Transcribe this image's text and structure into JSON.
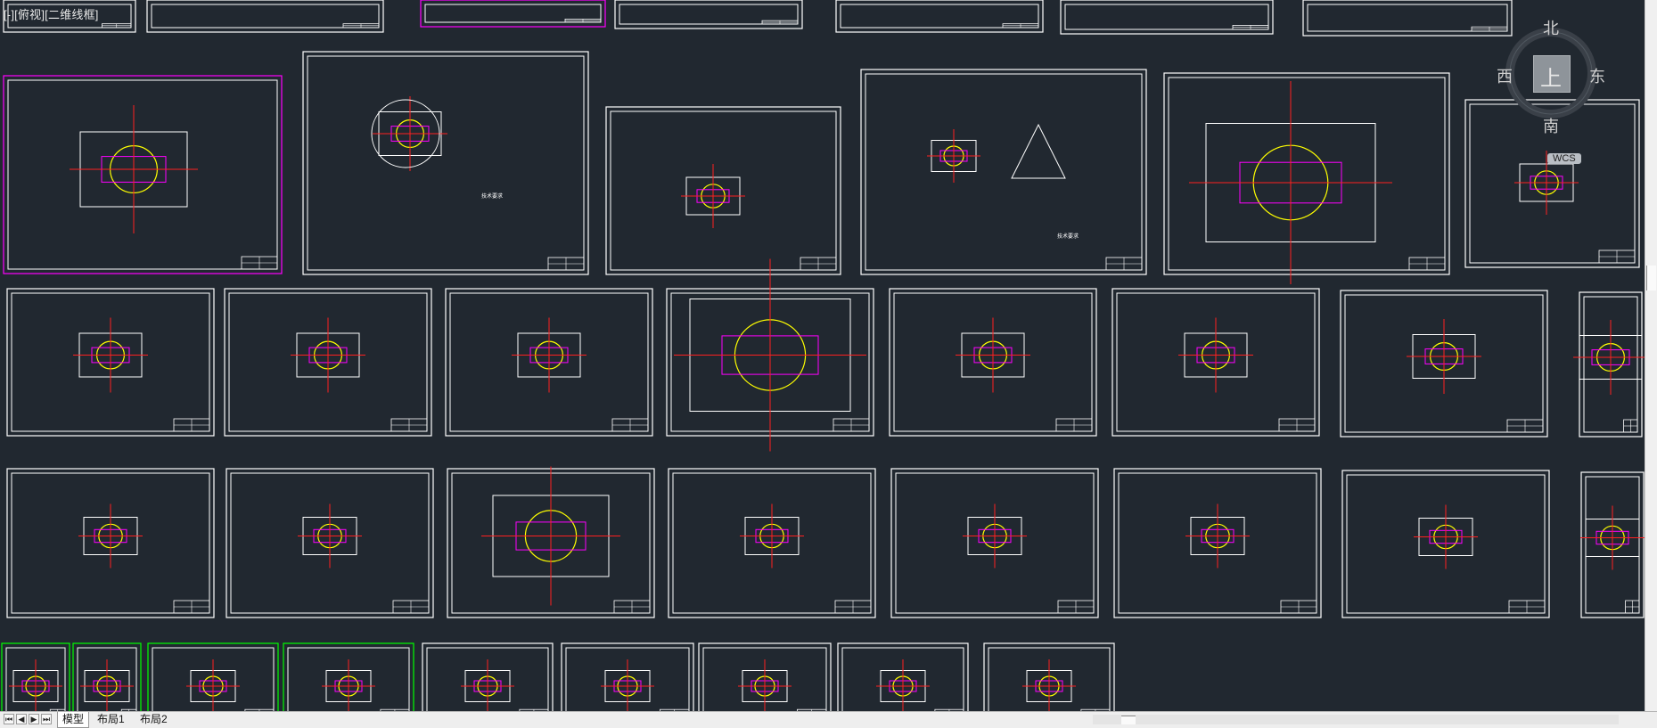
{
  "viewport": {
    "view_label": "[-][俯视][二维线框]"
  },
  "viewcube": {
    "north": "北",
    "south": "南",
    "east": "东",
    "west": "西",
    "top_face": "上",
    "wcs_label": "WCS"
  },
  "layout_tabs": [
    "模型",
    "布局1",
    "布局2"
  ],
  "active_tab": "模型",
  "drawing_text": {
    "tech_req_1": "技术要求",
    "tech_req_2": "技术要求"
  },
  "colors": {
    "background": "#212830",
    "sheet_border": "#ffffff",
    "magenta": "#ff00ff",
    "yellow": "#ffff00",
    "red": "#ff2020",
    "green": "#00ff00"
  },
  "icons": [
    "nav-first-icon",
    "nav-prev-icon",
    "nav-next-icon",
    "nav-last-icon",
    "compass-ring-icon"
  ]
}
